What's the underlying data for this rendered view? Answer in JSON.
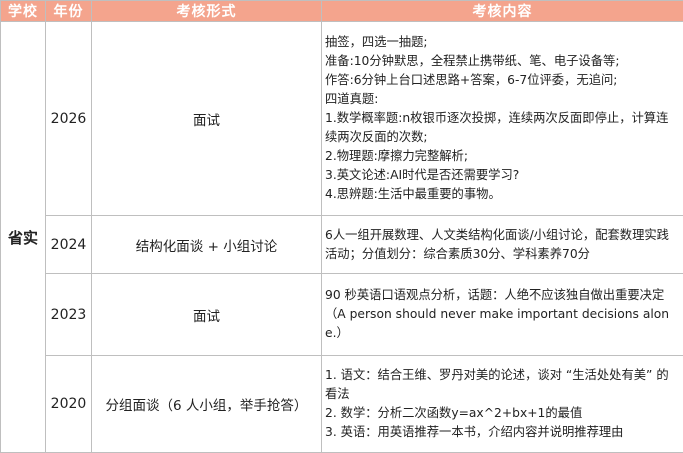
{
  "headers": {
    "school": "学校",
    "year": "年份",
    "form": "考核形式",
    "content": "考核内容"
  },
  "school_name": "省实",
  "rows": [
    {
      "year": "2026",
      "form": "面试",
      "lines": [
        "抽签，四选一抽题;",
        "准备:10分钟默思，全程禁止携带纸、笔、电子设备等;",
        "作答:6分钟上台口述思路+答案，6-7位评委，无追问;",
        "四道真题:",
        "1.数学概率题:n枚银币逐次投掷，连续两次反面即停止，计算连续两次反面的次数;",
        "2.物理题:摩擦力完整解析;",
        "3.英文论述:AI时代是否还需要学习?",
        "4.思辨题:生活中最重要的事物。"
      ]
    },
    {
      "year": "2024",
      "form": "结构化面谈 + 小组讨论",
      "lines": [
        "6人一组开展数理、人文类结构化面谈/小组讨论，配套数理实践活动；分值划分：综合素质30分、学科素养70分"
      ]
    },
    {
      "year": "2023",
      "form": "面试",
      "lines": [
        "90 秒英语口语观点分析，话题：人绝不应该独自做出重要决定（A person should never make important decisions alone.）"
      ]
    },
    {
      "year": "2020",
      "form": "分组面谈（6 人小组，举手抢答）",
      "lines": [
        "1. 语文：结合王维、罗丹对美的论述，谈对 “生活处处有美” 的看法",
        "2. 数学：分析二次函数y=ax^2+bx+1的最值",
        "3. 英语：用英语推荐一本书，介绍内容并说明推荐理由"
      ]
    }
  ]
}
